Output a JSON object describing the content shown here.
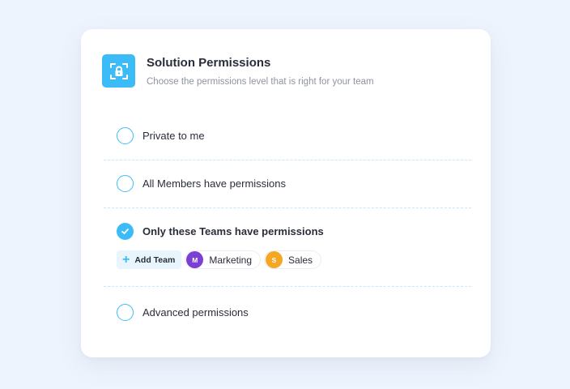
{
  "panel": {
    "title": "Solution Permissions",
    "subtitle": "Choose the permissions level that is right for your team",
    "icon": "lock-scan-icon"
  },
  "options": [
    {
      "label": "Private to me",
      "checked": false
    },
    {
      "label": "All Members have permissions",
      "checked": false
    },
    {
      "label": "Only these Teams have permissions",
      "checked": true
    },
    {
      "label": "Advanced permissions",
      "checked": false
    }
  ],
  "teams": {
    "add_label": "Add Team",
    "list": [
      {
        "initial": "M",
        "name": "Marketing",
        "color": "#7b3fd4"
      },
      {
        "initial": "S",
        "name": "Sales",
        "color": "#f5a623"
      }
    ]
  },
  "colors": {
    "accent": "#3cbcf6",
    "background": "#eef4fd"
  }
}
